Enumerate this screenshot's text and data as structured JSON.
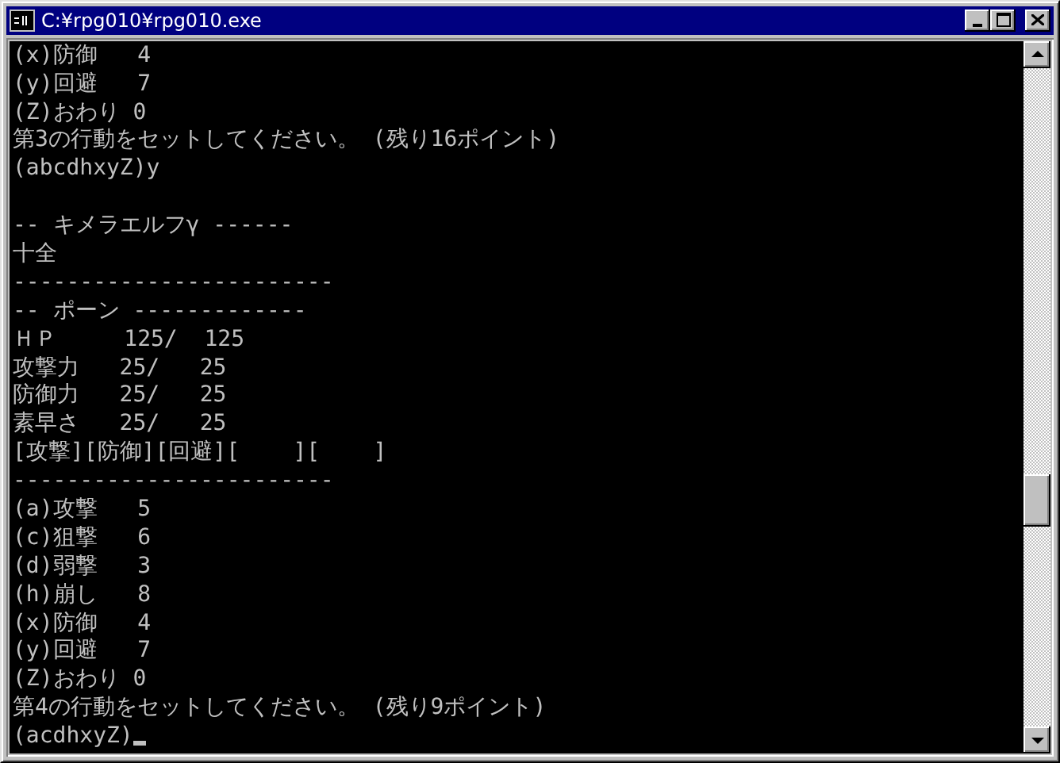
{
  "window": {
    "title": "C:¥rpg010¥rpg010.exe"
  },
  "console": {
    "blocks": [
      [
        "(x)防御   4",
        "(y)回避   7",
        "(Z)おわり 0",
        "第3の行動をセットしてください。 (残り16ポイント)",
        "(abcdhxyZ)y"
      ],
      [
        "-- キメラエルフγ ------",
        "十全",
        "------------------------",
        "-- ポーン -------------",
        "ＨＰ     125/  125",
        "攻撃力   25/   25",
        "防御力   25/   25",
        "素早さ   25/   25",
        "[攻撃][防御][回避][    ][    ]",
        "------------------------",
        "(a)攻撃   5",
        "(c)狙撃   6",
        "(d)弱撃   3",
        "(h)崩し   8",
        "(x)防御   4",
        "(y)回避   7",
        "(Z)おわり 0",
        "第4の行動をセットしてください。 (残り9ポイント)",
        "(acdhxyZ)"
      ]
    ],
    "cursor": true
  }
}
